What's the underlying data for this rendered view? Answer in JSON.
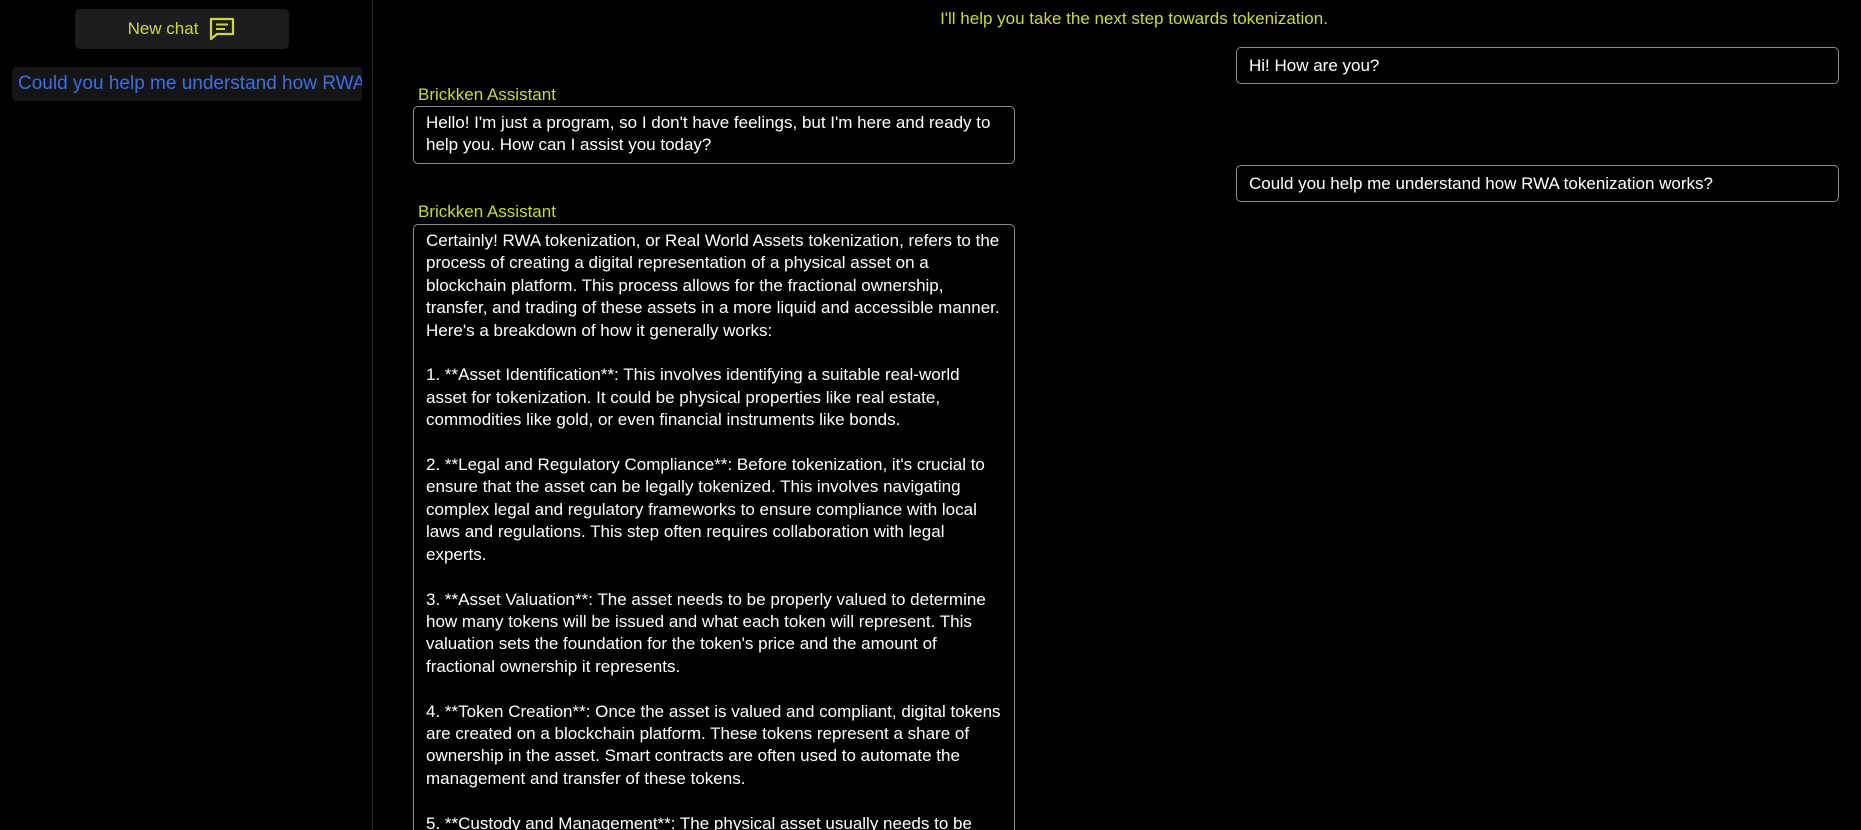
{
  "sidebar": {
    "new_chat_label": "New chat",
    "new_chat_icon": "chat-bubble-icon",
    "history": [
      {
        "label": "Could you help me understand how RWA tokenization works?"
      }
    ]
  },
  "main": {
    "tagline": "I'll help you take the next step towards tokenization.",
    "messages": [
      {
        "role": "user",
        "text": "Hi! How are you?"
      },
      {
        "role": "assistant",
        "speaker": "Brickken Assistant",
        "text": "Hello! I'm just a program, so I don't have feelings, but I'm here and ready to help you. How can I assist you today?"
      },
      {
        "role": "user",
        "text": "Could you help me understand how RWA tokenization works?"
      },
      {
        "role": "assistant",
        "speaker": "Brickken Assistant",
        "text": "Certainly! RWA tokenization, or Real World Assets tokenization, refers to the process of creating a digital representation of a physical asset on a blockchain platform. This process allows for the fractional ownership, transfer, and trading of these assets in a more liquid and accessible manner. Here's a breakdown of how it generally works:\n\n1. **Asset Identification**: This involves identifying a suitable real-world asset for tokenization. It could be physical properties like real estate, commodities like gold, or even financial instruments like bonds.\n\n2. **Legal and Regulatory Compliance**: Before tokenization, it's crucial to ensure that the asset can be legally tokenized. This involves navigating complex legal and regulatory frameworks to ensure compliance with local laws and regulations. This step often requires collaboration with legal experts.\n\n3. **Asset Valuation**: The asset needs to be properly valued to determine how many tokens will be issued and what each token will represent. This valuation sets the foundation for the token's price and the amount of fractional ownership it represents.\n\n4. **Token Creation**: Once the asset is valued and compliant, digital tokens are created on a blockchain platform. These tokens represent a share of ownership in the asset. Smart contracts are often used to automate the management and transfer of these tokens.\n\n5. **Custody and Management**: The physical asset usually needs to be"
      }
    ]
  },
  "colors": {
    "background": "#000000",
    "accent": "#c9d93b",
    "link": "#3b6fe0",
    "bubble_border": "#8a8a8a",
    "text": "#ffffff"
  }
}
